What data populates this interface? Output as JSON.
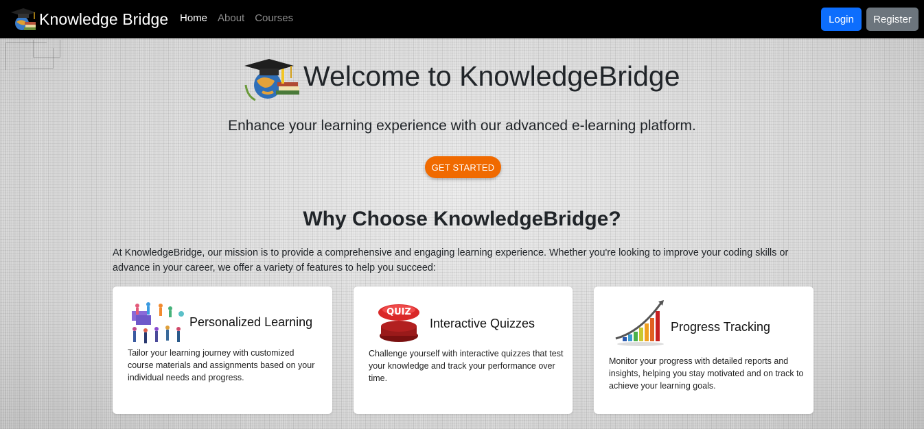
{
  "navbar": {
    "brand": "Knowledge Bridge",
    "links": [
      "Home",
      "About",
      "Courses"
    ],
    "login_label": "Login",
    "register_label": "Register",
    "colors": {
      "background": "#000000",
      "login": "#0d6efd",
      "register": "#6c757d"
    }
  },
  "hero": {
    "title": "Welcome to KnowledgeBridge",
    "subtitle": "Enhance your learning experience with our advanced e-learning platform.",
    "cta_label": "GET STARTED",
    "cta_color": "#f06a00"
  },
  "why": {
    "title": "Why Choose KnowledgeBridge?",
    "text": "At KnowledgeBridge, our mission is to provide a comprehensive and engaging learning experience. Whether you're looking to improve your coding skills or advance in your career, we offer a variety of features to help you succeed:"
  },
  "features": [
    {
      "icon": "people-learning-icon",
      "title": "Personalized Learning",
      "text": "Tailor your learning journey with customized course materials and assignments based on your individual needs and progress."
    },
    {
      "icon": "quiz-button-icon",
      "icon_label": "QUIZ",
      "title": "Interactive Quizzes",
      "text": "Challenge yourself with interactive quizzes that test your knowledge and track your performance over time."
    },
    {
      "icon": "growth-chart-icon",
      "title": "Progress Tracking",
      "text": "Monitor your progress with detailed reports and insights, helping you stay motivated and on track to achieve your learning goals."
    }
  ]
}
